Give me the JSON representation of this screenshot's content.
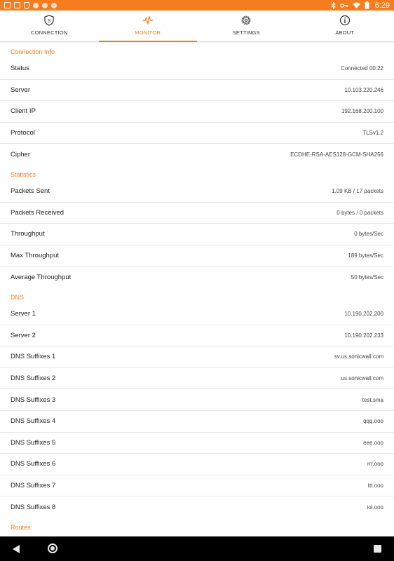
{
  "statusbar": {
    "time": "6:29",
    "left_icons": [
      "image-icon",
      "chart-icon",
      "shield-icon",
      "dot-icon",
      "dot-icon",
      "dot-icon"
    ],
    "right_icons": [
      "bluetooth-icon",
      "key-icon",
      "wifi-icon",
      "battery-icon"
    ]
  },
  "tabs": [
    {
      "label": "CONNECTION",
      "icon": "shield-s-icon",
      "active": false
    },
    {
      "label": "MONITOR",
      "icon": "pulse-icon",
      "active": true
    },
    {
      "label": "SETTINGS",
      "icon": "gear-icon",
      "active": false
    },
    {
      "label": "ABOUT",
      "icon": "info-icon",
      "active": false
    }
  ],
  "colors": {
    "accent": "#f57c1f",
    "divider": "#e6e6e6"
  },
  "connection_info": {
    "title": "Connection Info",
    "rows": [
      {
        "key": "Status",
        "value": "Connected 00:22"
      },
      {
        "key": "Server",
        "value": "10.103.220.246"
      },
      {
        "key": "Client IP",
        "value": "192.168.200.100"
      },
      {
        "key": "Protocol",
        "value": "TLSv1.2"
      },
      {
        "key": "Cipher",
        "value": "ECDHE-RSA-AES128-GCM-SHA256"
      }
    ]
  },
  "statistics": {
    "title": "Statistics",
    "rows": [
      {
        "key": "Packets Sent",
        "value": "1.09 KB / 17  packets"
      },
      {
        "key": "Packets Received",
        "value": "0  bytes / 0  packets"
      },
      {
        "key": "Throughput",
        "value": "0  bytes/Sec"
      },
      {
        "key": "Max Throughput",
        "value": "189  bytes/Sec"
      },
      {
        "key": "Average Throughput",
        "value": "50  bytes/Sec"
      }
    ]
  },
  "dns": {
    "title": "DNS",
    "rows": [
      {
        "key": "Server 1",
        "value": "10.190.202.200"
      },
      {
        "key": "Server 2",
        "value": "10.190.202.233"
      },
      {
        "key": "DNS Suffixes 1",
        "value": "sv.us.sonicwall.com"
      },
      {
        "key": "DNS Suffixes 2",
        "value": "us.sonicwall.com"
      },
      {
        "key": "DNS Suffixes 3",
        "value": "test.sma"
      },
      {
        "key": "DNS Suffixes 4",
        "value": "qqq.ooo"
      },
      {
        "key": "DNS Suffixes 5",
        "value": "eee.ooo"
      },
      {
        "key": "DNS Suffixes 6",
        "value": "rrr.ooo"
      },
      {
        "key": "DNS Suffixes 7",
        "value": "ttt.ooo"
      },
      {
        "key": "DNS Suffixes 8",
        "value": "ioi.ooo"
      }
    ]
  },
  "routes": {
    "title": "Routes"
  }
}
